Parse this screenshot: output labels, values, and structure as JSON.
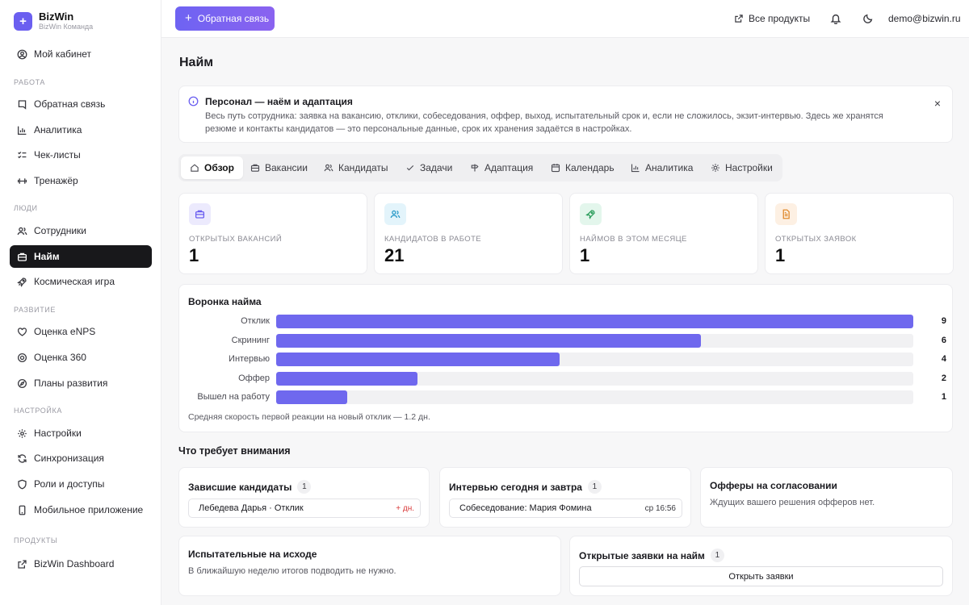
{
  "brand": {
    "name": "BizWin",
    "subtitle": "BizWin Команда",
    "logo": "+"
  },
  "sidebar": {
    "top_item": {
      "label": "Мой кабинет",
      "icon": "user-circle-icon"
    },
    "sections": [
      {
        "title": "РАБОТА",
        "items": [
          {
            "label": "Обратная связь",
            "icon": "feedback-icon"
          },
          {
            "label": "Аналитика",
            "icon": "bar-chart-icon"
          },
          {
            "label": "Чек-листы",
            "icon": "checklist-icon"
          },
          {
            "label": "Тренажёр",
            "icon": "dumbbell-icon"
          }
        ]
      },
      {
        "title": "ЛЮДИ",
        "items": [
          {
            "label": "Сотрудники",
            "icon": "users-icon"
          },
          {
            "label": "Найм",
            "icon": "briefcase-icon",
            "active": true
          },
          {
            "label": "Космическая игра",
            "icon": "rocket-icon"
          }
        ]
      },
      {
        "title": "РАЗВИТИЕ",
        "items": [
          {
            "label": "Оценка eNPS",
            "icon": "heart-icon"
          },
          {
            "label": "Оценка 360",
            "icon": "target-icon"
          },
          {
            "label": "Планы развития",
            "icon": "compass-icon"
          }
        ]
      },
      {
        "title": "НАСТРОЙКА",
        "items": [
          {
            "label": "Настройки",
            "icon": "gear-icon"
          },
          {
            "label": "Синхронизация",
            "icon": "sync-icon"
          },
          {
            "label": "Роли и доступы",
            "icon": "shield-icon"
          },
          {
            "label": "Мобильное приложение",
            "icon": "phone-icon"
          }
        ]
      },
      {
        "title": "ПРОДУКТЫ",
        "items": [
          {
            "label": "BizWin Dashboard",
            "icon": "external-link-icon"
          }
        ]
      }
    ]
  },
  "header": {
    "feedback_button": "Обратная связь",
    "all_products": "Все продукты",
    "user_email": "demo@bizwin.ru"
  },
  "page": {
    "title": "Найм",
    "info": {
      "title": "Персонал — наём и адаптация",
      "body": "Весь путь сотрудника: заявка на вакансию, отклики, собеседования, оффер, выход, испытательный срок и, если не сложилось, экзит-интервью. Здесь же хранятся резюме и контакты кандидатов — это персональные данные, срок их хранения задаётся в настройках.",
      "close": "×"
    },
    "tabs": [
      {
        "label": "Обзор",
        "icon": "home-icon",
        "active": true
      },
      {
        "label": "Вакансии",
        "icon": "briefcase-icon"
      },
      {
        "label": "Кандидаты",
        "icon": "users-icon"
      },
      {
        "label": "Задачи",
        "icon": "check-icon"
      },
      {
        "label": "Адаптация",
        "icon": "signpost-icon"
      },
      {
        "label": "Календарь",
        "icon": "calendar-icon"
      },
      {
        "label": "Аналитика",
        "icon": "bar-chart-icon"
      },
      {
        "label": "Настройки",
        "icon": "sun-gear-icon"
      }
    ],
    "stats": [
      {
        "label": "ОТКРЫТЫХ ВАКАНСИЙ",
        "value": "1",
        "icon": "briefcase-icon",
        "bg": "#eceafd",
        "color": "#6b5ff0"
      },
      {
        "label": "КАНДИДАТОВ В РАБОТЕ",
        "value": "21",
        "icon": "users-icon",
        "bg": "#e3f4fb",
        "color": "#2b9bc8"
      },
      {
        "label": "НАЙМОВ В ЭТОМ МЕСЯЦЕ",
        "value": "1",
        "icon": "rocket-icon",
        "bg": "#e3f6ec",
        "color": "#2e9e5e"
      },
      {
        "label": "ОТКРЫТЫХ ЗАЯВОК",
        "value": "1",
        "icon": "document-icon",
        "bg": "#fdf0e3",
        "color": "#e08a2e"
      }
    ],
    "funnel": {
      "title": "Воронка найма",
      "note": "Средняя скорость первой реакции на новый отклик — 1.2 дн.",
      "max": 9,
      "rows": [
        {
          "label": "Отклик",
          "value": 9
        },
        {
          "label": "Скрининг",
          "value": 6
        },
        {
          "label": "Интервью",
          "value": 4
        },
        {
          "label": "Оффер",
          "value": 2
        },
        {
          "label": "Вышел на работу",
          "value": 1
        }
      ]
    },
    "attention_title": "Что требует внимания",
    "attention": {
      "stuck": {
        "title": "Зависшие кандидаты",
        "count": "1",
        "row": "Лебедева Дарья · Отклик",
        "meta": "+ дн."
      },
      "interviews": {
        "title": "Интервью сегодня и завтра",
        "count": "1",
        "row": "Собеседование: Мария Фомина",
        "meta": "ср 16:56"
      },
      "offers": {
        "title": "Офферы на согласовании",
        "empty": "Ждущих вашего решения офферов нет."
      },
      "probation": {
        "title": "Испытательные на исходе",
        "empty": "В ближайшую неделю итогов подводить не нужно."
      },
      "requests": {
        "title": "Открытые заявки на найм",
        "count": "1",
        "button": "Открыть заявки"
      }
    }
  }
}
